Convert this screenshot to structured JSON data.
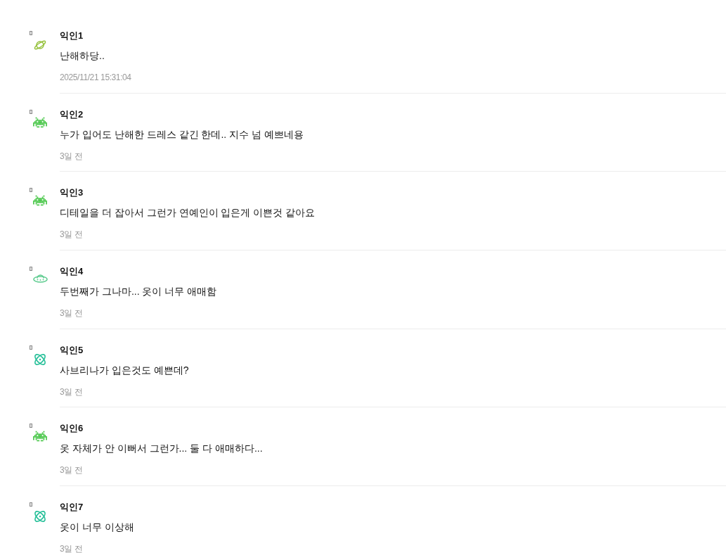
{
  "comments": [
    {
      "avatar": {
        "kind": "planet"
      },
      "author": "익인1",
      "text": "난해하당..",
      "time": "2025/11/21 15:31:04"
    },
    {
      "avatar": {
        "kind": "invader"
      },
      "author": "익인2",
      "text": "누가 입어도 난해한 드레스 같긴 한데.. 지수 넘 예쁘네용",
      "time": "3일 전"
    },
    {
      "avatar": {
        "kind": "invader"
      },
      "author": "익인3",
      "text": "디테일을 더 잡아서 그런가 연예인이 입은게 이쁜것 같아요",
      "time": "3일 전"
    },
    {
      "avatar": {
        "kind": "ufo"
      },
      "author": "익인4",
      "text": "두번째가 그나마... 옷이 너무 애매함",
      "time": "3일 전"
    },
    {
      "avatar": {
        "kind": "atom"
      },
      "author": "익인5",
      "text": "사브리나가 입은것도 예쁜데?",
      "time": "3일 전"
    },
    {
      "avatar": {
        "kind": "invader"
      },
      "author": "익인6",
      "text": "옷 자체가 안 이뻐서 그런가... 둘 다 애매하다...",
      "time": "3일 전"
    },
    {
      "avatar": {
        "kind": "atom"
      },
      "author": "익인7",
      "text": "옷이 너무 이상해",
      "time": "3일 전"
    }
  ]
}
